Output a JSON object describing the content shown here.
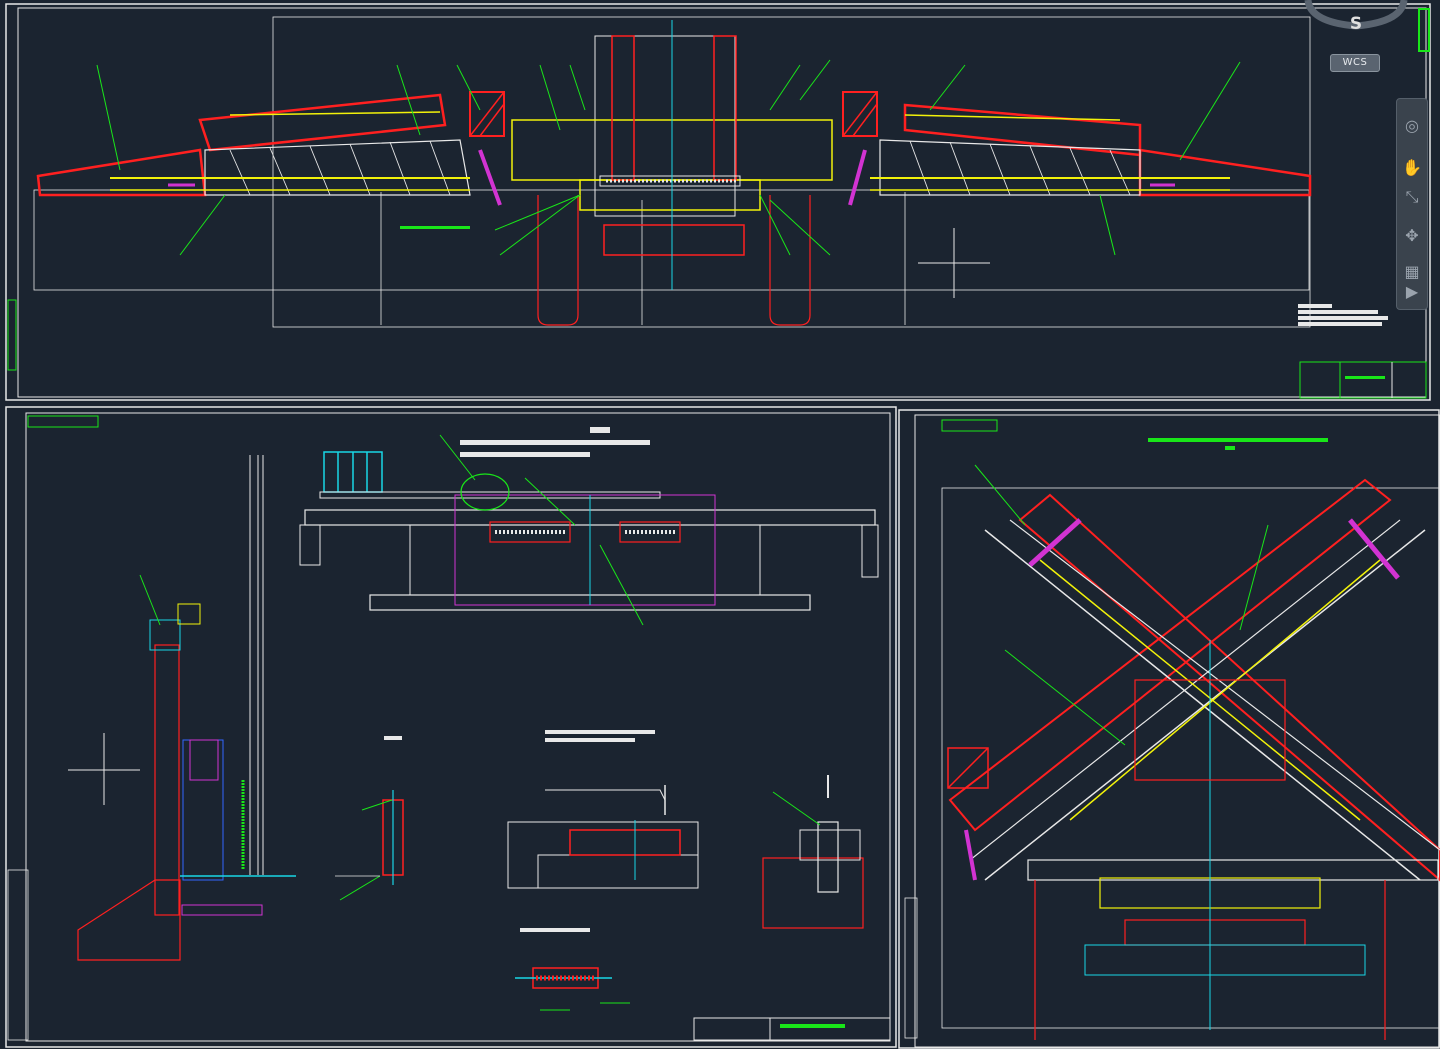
{
  "viewcube": {
    "north_letter": "S",
    "wcs_label": "WCS"
  },
  "navigation_bar": {
    "tools": [
      {
        "name": "steering-wheel-icon",
        "glyph": "◎"
      },
      {
        "name": "pan-hand-icon",
        "glyph": "✋"
      },
      {
        "name": "zoom-icon",
        "glyph": "⤡"
      },
      {
        "name": "orbit-icon",
        "glyph": "✥"
      },
      {
        "name": "showmotion-icon",
        "glyph": "▦"
      },
      {
        "name": "play-icon",
        "glyph": "▶"
      }
    ]
  },
  "colors": {
    "background": "#1b2430",
    "line_white": "#e8e8e8",
    "red": "#ff2020",
    "yellow": "#f2f20a",
    "green": "#19e619",
    "cyan": "#19d6e6",
    "magenta": "#d233d2",
    "blue": "#3366ff"
  }
}
